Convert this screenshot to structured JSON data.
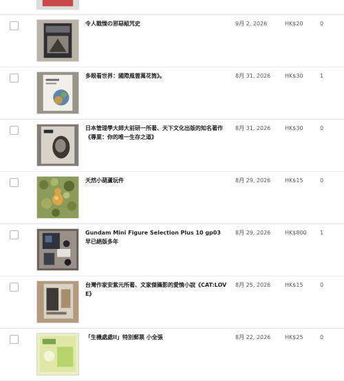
{
  "listings": [
    {
      "title": "",
      "date": "",
      "price": "",
      "count": "",
      "thumb_icon": "poster-thumbnail",
      "partial": "top"
    },
    {
      "title": "令人戰慄の邪惡組咒史",
      "date": "9月 2, 2026",
      "price": "HK$20",
      "count": "0",
      "thumb_icon": "book-cover-thumbnail"
    },
    {
      "title": "多眼看世界：國際風雲萬花筒》。",
      "date": "8月 31, 2026",
      "price": "HK$30",
      "count": "1",
      "thumb_icon": "book-cover-thumbnail"
    },
    {
      "title": "日本管理學大師大前研一所著、天下文化出版的知名著作《專業：你的唯一生存之道》",
      "date": "8月 31, 2026",
      "price": "HK$30",
      "count": "0",
      "thumb_icon": "book-cover-thumbnail"
    },
    {
      "title": "天然小葫蘆玩件",
      "date": "8月 29, 2026",
      "price": "HK$15",
      "count": "0",
      "thumb_icon": "gourd-photo-thumbnail"
    },
    {
      "title": "Gundam Mini Figure Selection Plus 10 gp03 早已絕版多年",
      "date": "8月 29, 2026",
      "price": "HK$800",
      "count": "1",
      "thumb_icon": "figure-photo-thumbnail"
    },
    {
      "title": "台灣作家安紫元所著、文家傑攝影的愛情小說《CAT:LOVE》",
      "date": "8月 25, 2026",
      "price": "HK$15",
      "count": "0",
      "thumb_icon": "book-cover-thumbnail"
    },
    {
      "title": "「生機處處II」特別郵票 小全張",
      "date": "8月 22, 2026",
      "price": "HK$25",
      "count": "0",
      "thumb_icon": "stamp-sheet-thumbnail"
    }
  ]
}
